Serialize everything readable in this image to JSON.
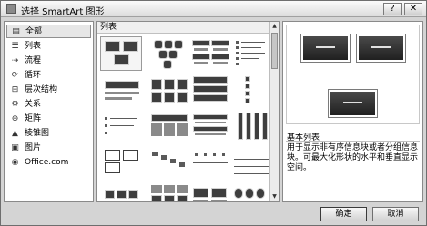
{
  "window": {
    "title": "选择 SmartArt 图形",
    "help": "?",
    "close": "✕"
  },
  "categories": [
    {
      "label": "全部",
      "icon": "all-icon",
      "glyph": "▤"
    },
    {
      "label": "列表",
      "icon": "list-icon",
      "glyph": "☰"
    },
    {
      "label": "流程",
      "icon": "process-icon",
      "glyph": "⇢"
    },
    {
      "label": "循环",
      "icon": "cycle-icon",
      "glyph": "⟳"
    },
    {
      "label": "层次结构",
      "icon": "hierarchy-icon",
      "glyph": "⊞"
    },
    {
      "label": "关系",
      "icon": "relationship-icon",
      "glyph": "⚙"
    },
    {
      "label": "矩阵",
      "icon": "matrix-icon",
      "glyph": "⊕"
    },
    {
      "label": "棱锥图",
      "icon": "pyramid-icon",
      "glyph": "▲"
    },
    {
      "label": "图片",
      "icon": "picture-icon",
      "glyph": "▣"
    },
    {
      "label": "Office.com",
      "icon": "office-icon",
      "glyph": "◉"
    }
  ],
  "middle": {
    "header": "列表",
    "scroll_up": "▲",
    "scroll_down": "▼"
  },
  "details": {
    "name": "基本列表",
    "description": "用于显示非有序信息块或者分组信息块。可最大化形状的水平和垂直显示空间。"
  },
  "buttons": {
    "ok": "确定",
    "cancel": "取消"
  }
}
